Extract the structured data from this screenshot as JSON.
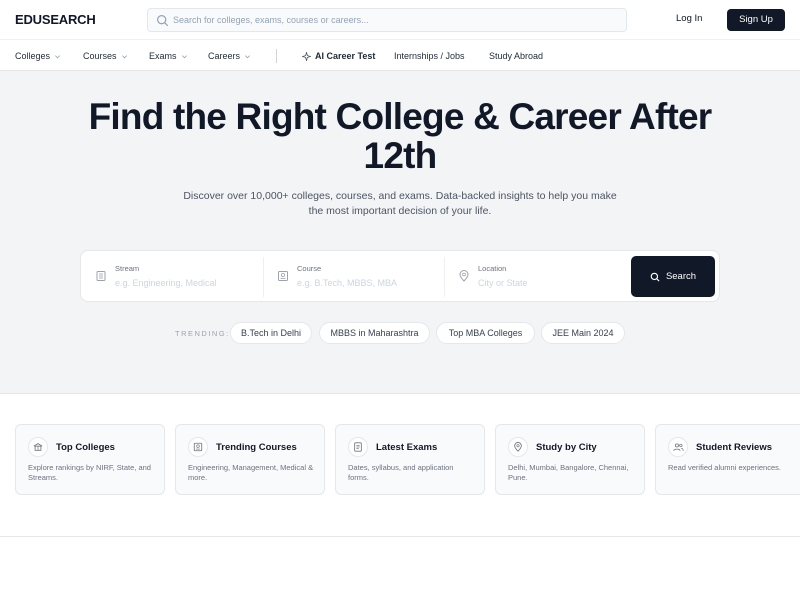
{
  "header": {
    "logo": "EDUSEARCH",
    "search_placeholder": "Search for colleges, exams, courses or careers...",
    "login_label": "Log In",
    "signup_label": "Sign Up"
  },
  "nav": {
    "items": [
      {
        "label": "Colleges",
        "dropdown": true
      },
      {
        "label": "Courses",
        "dropdown": true
      },
      {
        "label": "Exams",
        "dropdown": true
      },
      {
        "label": "Careers",
        "dropdown": true
      },
      {
        "label": "AI Career Test",
        "icon": "sparkle-icon"
      },
      {
        "label": "Internships / Jobs"
      },
      {
        "label": "Study Abroad"
      }
    ]
  },
  "hero": {
    "title": "Find the Right College & Career After 12th",
    "subtitle": "Discover over 10,000+ colleges, courses, and exams. Data-backed insights to help you make the most important decision of your life.",
    "fields": [
      {
        "label": "Stream",
        "placeholder": "e.g. Engineering, Medical",
        "icon": "building-icon"
      },
      {
        "label": "Course",
        "placeholder": "e.g. B.Tech, MBBS, MBA",
        "icon": "book-icon"
      },
      {
        "label": "Location",
        "placeholder": "City or State",
        "icon": "map-pin-icon"
      }
    ],
    "search_button": "Search",
    "trending_label": "TRENDING:",
    "trending": [
      "B.Tech in Delhi",
      "MBBS in Maharashtra",
      "Top MBA Colleges",
      "JEE Main 2024"
    ]
  },
  "cards": [
    {
      "title": "Top Colleges",
      "desc": "Explore rankings by NIRF, State, and Streams.",
      "icon": "building-icon"
    },
    {
      "title": "Trending Courses",
      "desc": "Engineering, Management, Medical & more.",
      "icon": "badge-icon"
    },
    {
      "title": "Latest Exams",
      "desc": "Dates, syllabus, and application forms.",
      "icon": "document-icon"
    },
    {
      "title": "Study by City",
      "desc": "Delhi, Mumbai, Bangalore, Chennai, Pune.",
      "icon": "map-pin-icon"
    },
    {
      "title": "Student Reviews",
      "desc": "Read verified alumni experiences.",
      "icon": "users-icon"
    }
  ],
  "colors": {
    "primary": "#111827",
    "hero_bg": "#f3f4f6",
    "border": "#e5e7eb",
    "muted": "#6b7280"
  }
}
